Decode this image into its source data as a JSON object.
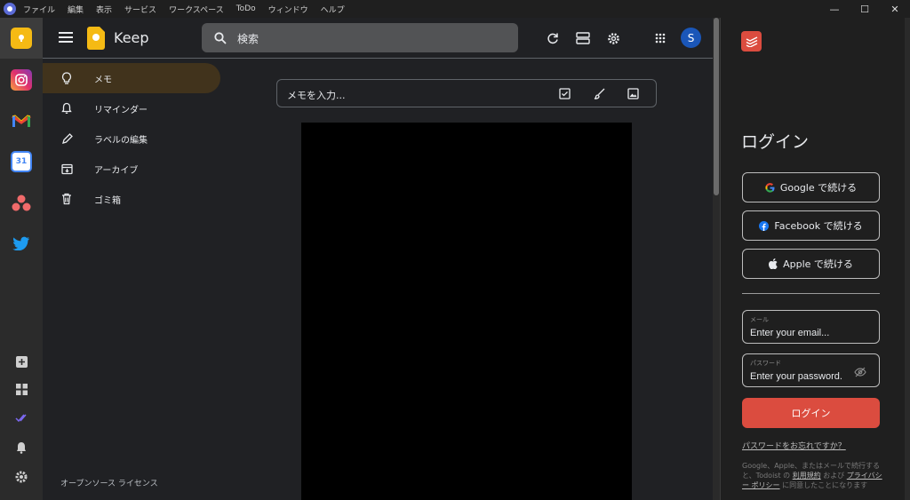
{
  "titlebar": {
    "menu": [
      "ファイル",
      "編集",
      "表示",
      "サービス",
      "ワークスペース",
      "ToDo",
      "ウィンドウ",
      "ヘルプ"
    ]
  },
  "rail": {
    "apps": [
      "keep-icon",
      "instagram-icon",
      "gmail-icon",
      "calendar-icon",
      "asana-icon",
      "twitter-icon"
    ],
    "calendar_day": "31",
    "tools": [
      "add-icon",
      "grid-icon",
      "checklist-icon",
      "bell-icon",
      "gear-icon"
    ]
  },
  "keep": {
    "title": "Keep",
    "search_placeholder": "検索",
    "avatar_initial": "S",
    "nav": [
      {
        "label": "メモ",
        "icon": "lightbulb-icon"
      },
      {
        "label": "リマインダー",
        "icon": "bell-icon"
      },
      {
        "label": "ラベルの編集",
        "icon": "pencil-icon"
      },
      {
        "label": "アーカイブ",
        "icon": "archive-icon"
      },
      {
        "label": "ゴミ箱",
        "icon": "trash-icon"
      }
    ],
    "license": "オープンソース ライセンス",
    "note_placeholder": "メモを入力..."
  },
  "todoist": {
    "login_title": "ログイン",
    "google": "Google で続ける",
    "facebook": "Facebook で続ける",
    "apple": "Apple で続ける",
    "email_label": "メール",
    "email_placeholder": "Enter your email...",
    "password_label": "パスワード",
    "password_placeholder": "Enter your password...",
    "login_button": "ログイン",
    "forgot": "パスワードをお忘れですか？",
    "terms_1": "Google、Apple、またはメールで続行すると、Todoist の",
    "terms_link_1": "利用規約",
    "terms_2": "および",
    "terms_link_2": "プライバシー ポリシー",
    "terms_3": "に同意したことになります"
  },
  "colors": {
    "accent_keep": "#f5ba14",
    "accent_todoist": "#db4c3f",
    "active_nav": "#41331c"
  }
}
